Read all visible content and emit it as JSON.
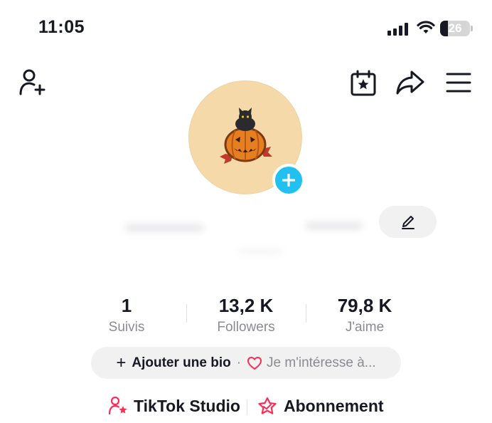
{
  "status_bar": {
    "time": "11:05",
    "battery_level": "26",
    "battery_fraction": 0.26
  },
  "header": {
    "icons": [
      "add-user-icon",
      "calendar-star-icon",
      "share-icon",
      "menu-icon"
    ]
  },
  "avatar": {
    "image": "pumpkin-with-black-cat-icon",
    "ring_color": "#f6d9a9",
    "add_badge_color": "#20c0f0"
  },
  "stats": [
    {
      "value": "1",
      "label": "Suivis"
    },
    {
      "value": "13,2 K",
      "label": "Followers"
    },
    {
      "value": "79,8 K",
      "label": "J'aime"
    }
  ],
  "bio": {
    "add_label": "Ajouter une bio",
    "separator": "·",
    "interest_label": "Je m'intéresse à..."
  },
  "links": {
    "studio_label": "TikTok Studio",
    "subscription_label": "Abonnement"
  },
  "colors": {
    "accent_pink": "#fe2c55",
    "text_primary": "#161823",
    "text_secondary": "#8a8b91",
    "pill_bg": "#f1f1f2"
  }
}
